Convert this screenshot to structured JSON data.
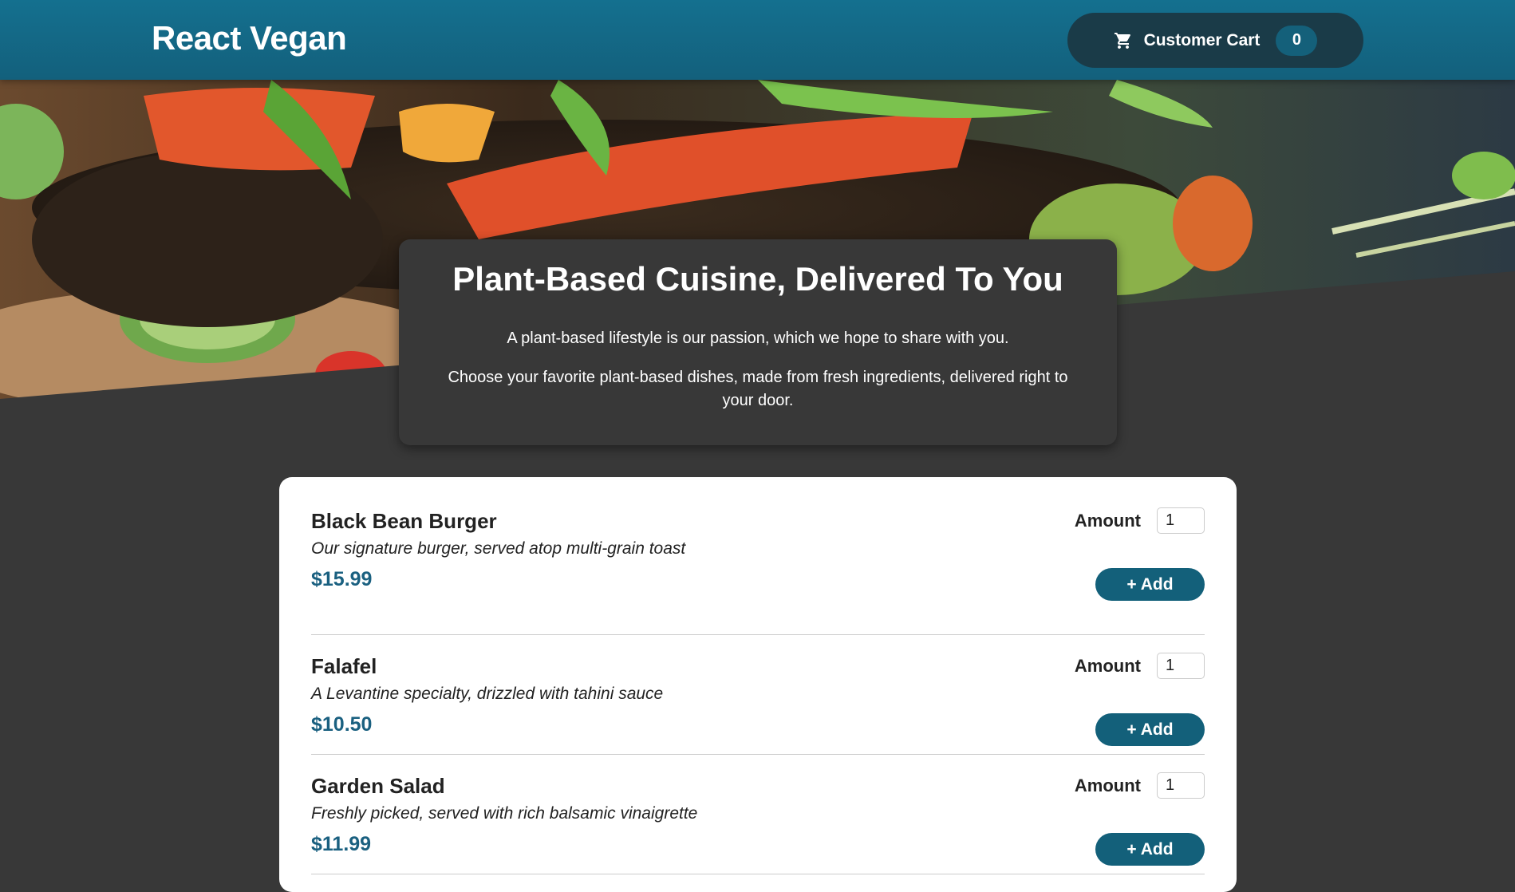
{
  "header": {
    "brand": "React Vegan",
    "cart_label": "Customer Cart",
    "cart_count": "0",
    "cart_icon": "shopping-cart-icon"
  },
  "intro": {
    "title": "Plant-Based Cuisine, Delivered To You",
    "paragraph_1": "A plant-based lifestyle is our passion, which we hope to share with you.",
    "paragraph_2": "Choose your favorite plant-based dishes, made from fresh ingredients, delivered right to your door."
  },
  "meals": [
    {
      "name": "Black Bean Burger",
      "description": "Our signature burger, served atop multi-grain toast",
      "price": "$15.99",
      "amount_label": "Amount",
      "amount_value": "1",
      "add_label": "+ Add"
    },
    {
      "name": "Falafel",
      "description": "A Levantine specialty, drizzled with tahini sauce",
      "price": "$10.50",
      "amount_label": "Amount",
      "amount_value": "1",
      "add_label": "+ Add"
    },
    {
      "name": "Garden Salad",
      "description": "Freshly picked, served with rich balsamic vinaigrette",
      "price": "$11.99",
      "amount_label": "Amount",
      "amount_value": "1",
      "add_label": "+ Add"
    }
  ],
  "colors": {
    "header": "#14708f",
    "accent": "#13607a",
    "price": "#1a6080",
    "background": "#383838"
  }
}
